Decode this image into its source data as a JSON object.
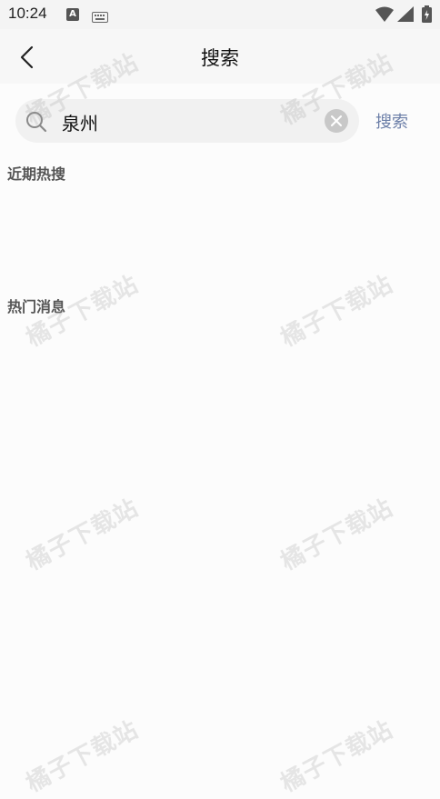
{
  "status_bar": {
    "time": "10:24",
    "notification_glyph": "A",
    "icons": [
      "keyboard-icon",
      "wifi-icon",
      "signal-icon",
      "battery-icon"
    ]
  },
  "nav": {
    "title": "搜索",
    "back_icon": "chevron-left-icon"
  },
  "search": {
    "value": "泉州",
    "icon": "search-icon",
    "clear_icon": "close-icon",
    "button_label": "搜索"
  },
  "sections": {
    "recent_title": "近期热搜",
    "hot_title": "热门消息"
  },
  "watermark": {
    "text": "橘子下载站"
  },
  "colors": {
    "accent_link": "#6c7fa8",
    "background": "#fcfcfc",
    "search_field": "#f1f1f1"
  }
}
